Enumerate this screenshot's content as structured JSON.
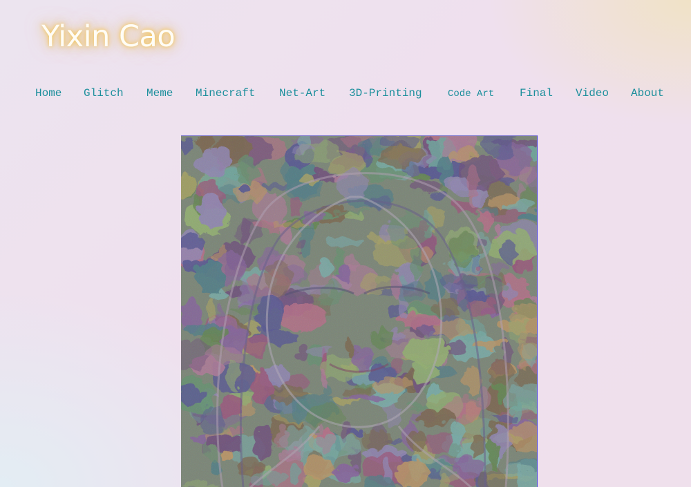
{
  "site": {
    "title": "Yixin Cao"
  },
  "nav": {
    "items": [
      {
        "label": "Home"
      },
      {
        "label": "Glitch"
      },
      {
        "label": "Meme"
      },
      {
        "label": "Minecraft"
      },
      {
        "label": "Net-Art"
      },
      {
        "label": "3D-Printing"
      },
      {
        "label": "Code Art"
      },
      {
        "label": "Final"
      },
      {
        "label": "Video"
      },
      {
        "label": "About"
      }
    ]
  },
  "colors": {
    "nav_link": "#1c8f9c",
    "title_text": "#fffdf6",
    "title_glow": "#f6c446"
  },
  "artwork": {
    "kind": "glitch-portrait-image"
  }
}
